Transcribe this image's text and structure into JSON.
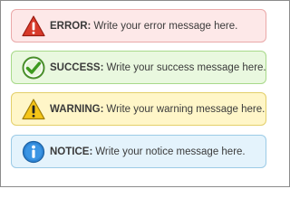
{
  "messages": [
    {
      "type": "error",
      "label": "ERROR:",
      "text": "Write your error message here.",
      "icon": "error-triangle-icon",
      "background": "#fde8e8",
      "border": "#eaa9a9"
    },
    {
      "type": "success",
      "label": "SUCCESS:",
      "text": "Write your success message here.",
      "icon": "success-check-icon",
      "background": "#e9f8df",
      "border": "#a8d98a"
    },
    {
      "type": "warning",
      "label": "WARNING:",
      "text": "Write your warning message here.",
      "icon": "warning-triangle-icon",
      "background": "#fff6c8",
      "border": "#e3cf6a"
    },
    {
      "type": "notice",
      "label": "NOTICE:",
      "text": "Write your notice message here.",
      "icon": "info-circle-icon",
      "background": "#e4f3fc",
      "border": "#9ccbe6"
    }
  ]
}
